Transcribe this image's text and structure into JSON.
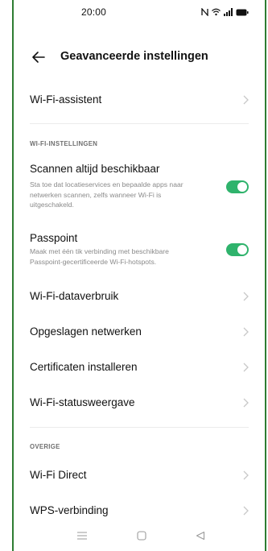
{
  "status_bar": {
    "time": "20:00",
    "icons": [
      "nfc-icon",
      "wifi-icon",
      "signal-icon",
      "battery-icon"
    ]
  },
  "header": {
    "title": "Geavanceerde instellingen",
    "back_icon": "arrow-left-icon"
  },
  "items": {
    "wifi_assistant": {
      "label": "Wi-Fi-assistent"
    },
    "scan_always": {
      "label": "Scannen altijd beschikbaar",
      "description": "Sta toe dat locatieservices en bepaalde apps naar netwerken scannen, zelfs wanneer Wi-Fi is uitgeschakeld.",
      "enabled": true
    },
    "passpoint": {
      "label": "Passpoint",
      "description": "Maak met één tik verbinding met beschikbare Passpoint-gecertificeerde Wi-Fi-hotspots.",
      "enabled": true
    },
    "data_usage": {
      "label": "Wi-Fi-dataverbruik"
    },
    "saved_networks": {
      "label": "Opgeslagen netwerken"
    },
    "install_certs": {
      "label": "Certificaten installeren"
    },
    "status_view": {
      "label": "Wi-Fi-statusweergave"
    },
    "wifi_direct": {
      "label": "Wi-Fi Direct"
    },
    "wps": {
      "label": "WPS-verbinding"
    }
  },
  "sections": {
    "wifi_settings": "WI-FI-INSTELLINGEN",
    "other": "OVERIGE"
  },
  "colors": {
    "toggle_on": "#2fb36c",
    "frame_border": "#2e7d32"
  },
  "navbar": [
    "menu-icon",
    "home-icon",
    "back-triangle-icon"
  ]
}
